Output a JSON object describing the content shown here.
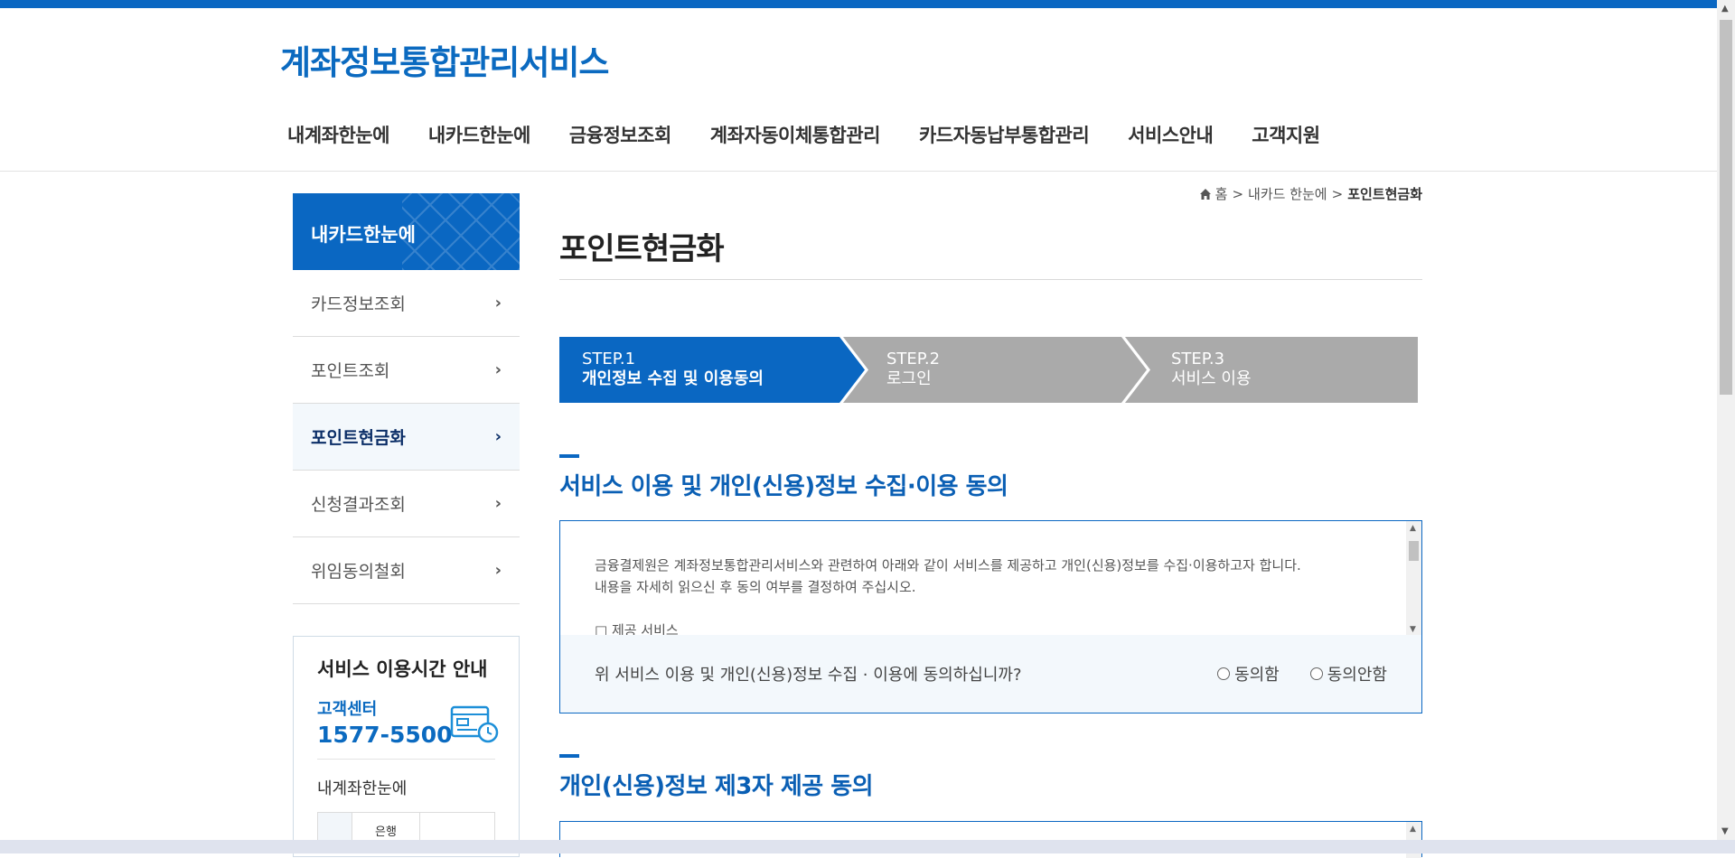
{
  "header": {
    "logo": "계좌정보통합관리서비스",
    "nav": [
      "내계좌한눈에",
      "내카드한눈에",
      "금융정보조회",
      "계좌자동이체통합관리",
      "카드자동납부통합관리",
      "서비스안내",
      "고객지원"
    ]
  },
  "sidebar": {
    "title": "내카드한눈에",
    "items": [
      {
        "label": "카드정보조회",
        "active": false
      },
      {
        "label": "포인트조회",
        "active": false
      },
      {
        "label": "포인트현금화",
        "active": true
      },
      {
        "label": "신청결과조회",
        "active": false
      },
      {
        "label": "위임동의철회",
        "active": false
      }
    ],
    "chevron": "›"
  },
  "infobox": {
    "title": "서비스 이용시간 안내",
    "center_label": "고객센터",
    "phone": "1577-5500",
    "sub_title": "내계좌한눈에",
    "table_header": "은행"
  },
  "breadcrumb": {
    "home": "홈",
    "sep": ">",
    "level1": "내카드 한눈에",
    "current": "포인트현금화"
  },
  "page_title": "포인트현금화",
  "steps": [
    {
      "num": "STEP.1",
      "label": "개인정보 수집 및 이용동의",
      "active": true
    },
    {
      "num": "STEP.2",
      "label": "로그인",
      "active": false
    },
    {
      "num": "STEP.3",
      "label": "서비스 이용",
      "active": false
    }
  ],
  "section1": {
    "heading": "서비스 이용 및 개인(신용)정보 수집·이용 동의",
    "text_line1": "금융결제원은 계좌정보통합관리서비스와 관련하여 아래와 같이 서비스를 제공하고 개인(신용)정보를 수집·이용하고자 합니다.",
    "text_line2": "내용을 자세히 읽으신 후 동의 여부를 결정하여 주십시오.",
    "text_line3": "□ 제공 서비스",
    "question": "위 서비스 이용 및 개인(신용)정보 수집 · 이용에 동의하십니까?",
    "agree": "동의함",
    "disagree": "동의안함"
  },
  "section2": {
    "heading": "개인(신용)정보 제3자 제공 동의"
  },
  "colors": {
    "brand": "#0a67c2",
    "step_inactive": "#aaaaaa",
    "sidebar_active_text": "#0b2e67"
  },
  "icons": {
    "home": "home-icon",
    "calendar": "calendar-clock-icon",
    "chevron": "chevron-right-icon"
  }
}
